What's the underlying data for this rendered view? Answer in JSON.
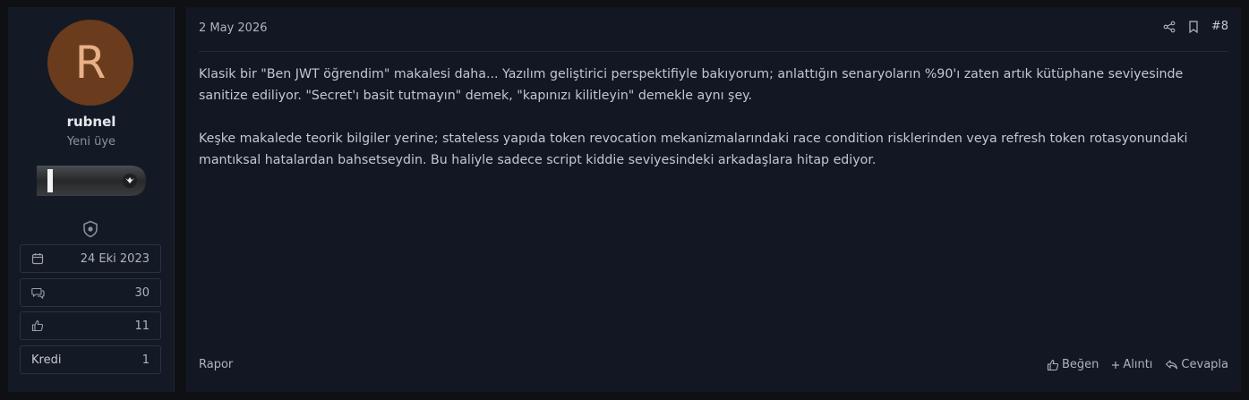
{
  "user": {
    "avatar_letter": "R",
    "name": "rubnel",
    "title": "Yeni üye",
    "avatar_bg": "#6a3b1c",
    "stats": [
      {
        "icon": "calendar-icon",
        "value": "24 Eki 2023"
      },
      {
        "icon": "messages-icon",
        "value": "30"
      },
      {
        "icon": "thumbs-up-icon",
        "value": "11"
      },
      {
        "label": "Kredi",
        "value": "1"
      }
    ]
  },
  "post": {
    "date": "2 May 2026",
    "number": "#8",
    "paragraphs": [
      "Klasik bir \"Ben JWT öğrendim\" makalesi daha... Yazılım geliştirici perspektifiyle bakıyorum; anlattığın senaryoların %90'ı zaten artık kütüphane seviyesinde sanitize ediliyor. \"Secret'ı basit tutmayın\" demek, \"kapınızı kilitleyin\" demekle aynı şey.",
      "Keşke makalede teorik bilgiler yerine; stateless yapıda token revocation mekanizmalarındaki race condition risklerinden veya refresh token rotasyonundaki mantıksal hatalardan bahsetseydin. Bu haliyle sadece script kiddie seviyesindeki arkadaşlara hitap ediyor."
    ],
    "report_label": "Rapor",
    "actions": {
      "like": "Beğen",
      "quote": "Alıntı",
      "reply": "Cevapla"
    }
  }
}
